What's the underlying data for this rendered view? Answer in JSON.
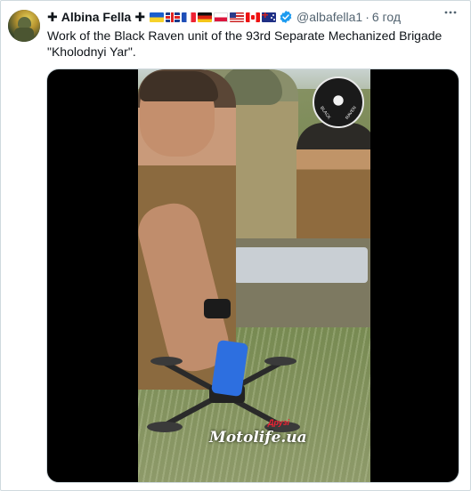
{
  "author": {
    "prefix_symbol": "✚",
    "display_name": "Albina Fella",
    "suffix_symbol": "✚",
    "flags": [
      "ua",
      "gb",
      "fr",
      "de",
      "pl",
      "us",
      "ca",
      "au"
    ],
    "verified": true,
    "handle": "@albafella1",
    "separator": "·",
    "time": "6 год"
  },
  "tweet": {
    "text": "Work of the Black Raven unit of the 93rd Separate Mechanized Brigade \"Kholodnyi Yar\"."
  },
  "media": {
    "type": "video",
    "logo_text_left": "BLACK",
    "logo_text_right": "RAVEN",
    "watermark_text": "Motolife.ua",
    "watermark_badge": "Друзі"
  },
  "colors": {
    "verified_blue": "#1d9bf0",
    "secondary_text": "#536471",
    "primary_text": "#0f1419",
    "border": "#cfd9de"
  }
}
